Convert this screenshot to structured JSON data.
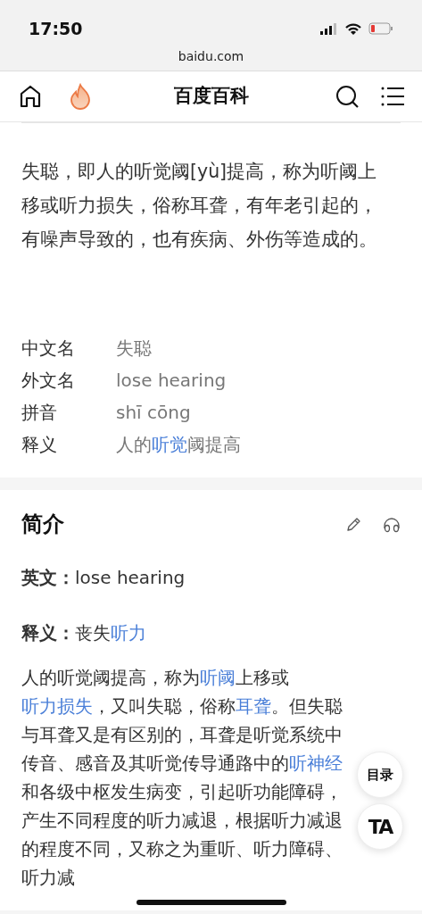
{
  "status_bar": {
    "time": "17:50"
  },
  "browser": {
    "url": "baidu.com"
  },
  "nav": {
    "title": "百度百科"
  },
  "intro": {
    "text": "失聪，即人的听觉阈[yù]提高，称为听阈上移或听力损失，俗称耳聋，有年老引起的，有噪声导致的，也有疾病、外伤等造成的。"
  },
  "info": [
    {
      "label": "中文名",
      "value": [
        {
          "text": "失聪",
          "link": false
        }
      ]
    },
    {
      "label": "外文名",
      "value": [
        {
          "text": "lose hearing",
          "link": false
        }
      ]
    },
    {
      "label": "拼音",
      "value": [
        {
          "text": "shī cōng",
          "link": false
        }
      ]
    },
    {
      "label": "释义",
      "value": [
        {
          "text": "人的",
          "link": false
        },
        {
          "text": "听觉",
          "link": true
        },
        {
          "text": "阈提高",
          "link": false
        }
      ]
    }
  ],
  "section": {
    "title": "简介",
    "facts": [
      {
        "label": "英文：",
        "value": [
          {
            "text": "lose hearing",
            "link": false
          }
        ]
      },
      {
        "label": "释义：",
        "value": [
          {
            "text": "丧失",
            "link": false
          },
          {
            "text": "听力",
            "link": true
          }
        ]
      }
    ],
    "body": [
      {
        "text": "人的听觉阈提高，称为",
        "link": false
      },
      {
        "text": "听阈",
        "link": true
      },
      {
        "text": "上移或",
        "link": false
      },
      {
        "text": "听力损失",
        "link": true
      },
      {
        "text": "，又叫失聪，俗称",
        "link": false
      },
      {
        "text": "耳聋",
        "link": true
      },
      {
        "text": "。但失聪与耳聋又是有区别的，耳聋是听觉系统中传音、感音及其听觉传导通路中的",
        "link": false
      },
      {
        "text": "听神经",
        "link": true
      },
      {
        "text": "和各级中枢发生病变，引起听功能障碍，产生不同程度的听力减退，根据听力减退的程度不同，又称之为重听、听力障碍、听力减",
        "link": false
      }
    ]
  },
  "floating_buttons": [
    {
      "kind": "text",
      "label": "目录"
    },
    {
      "kind": "logo",
      "label": "TA"
    }
  ]
}
